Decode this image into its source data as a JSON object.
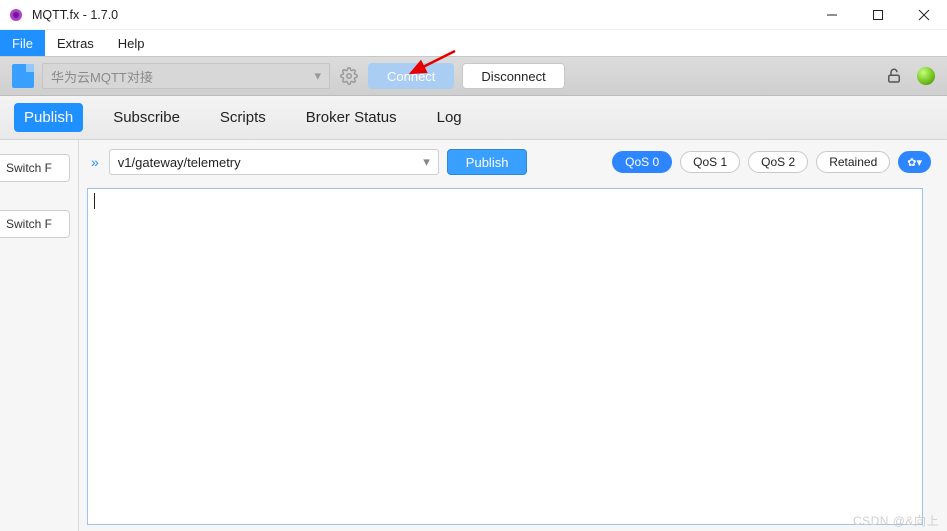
{
  "window": {
    "title": "MQTT.fx - 1.7.0"
  },
  "menu": {
    "file": "File",
    "extras": "Extras",
    "help": "Help"
  },
  "conn": {
    "profile_name": "华为云MQTT对接",
    "connect_label": "Connect",
    "disconnect_label": "Disconnect"
  },
  "tabs": {
    "publish": "Publish",
    "subscribe": "Subscribe",
    "scripts": "Scripts",
    "broker_status": "Broker Status",
    "log": "Log"
  },
  "left": {
    "switch1": "Switch F",
    "switch2": "Switch F"
  },
  "publish": {
    "topic": "v1/gateway/telemetry",
    "publish_label": "Publish",
    "qos0": "QoS 0",
    "qos1": "QoS 1",
    "qos2": "QoS 2",
    "retained": "Retained",
    "payload": ""
  },
  "watermark": "CSDN @&向上"
}
